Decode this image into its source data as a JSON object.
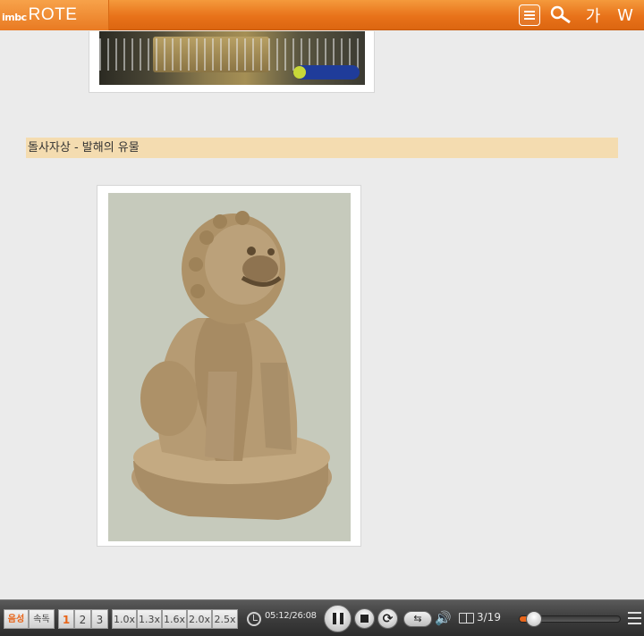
{
  "header": {
    "logo_small": "imbc",
    "logo_big": "ROTE",
    "icons": {
      "menu": "menu-icon",
      "search": "search-icon",
      "font": "font-size-icon",
      "bookmark": "bookmark-icon"
    },
    "font_label": "가",
    "bookmark_label": "W"
  },
  "content": {
    "caption": "돌사자상 - 발해의 유물"
  },
  "player": {
    "audio_label": "음성",
    "speed_read_label": "속독",
    "voices": [
      "1",
      "2",
      "3"
    ],
    "speeds": [
      "1.0x",
      "1.3x",
      "1.6x",
      "2.0x",
      "2.5x"
    ],
    "time": "05:12/26:08",
    "pages": "3/19",
    "progress_fraction": 0.12,
    "accent_color": "#e8651a"
  }
}
